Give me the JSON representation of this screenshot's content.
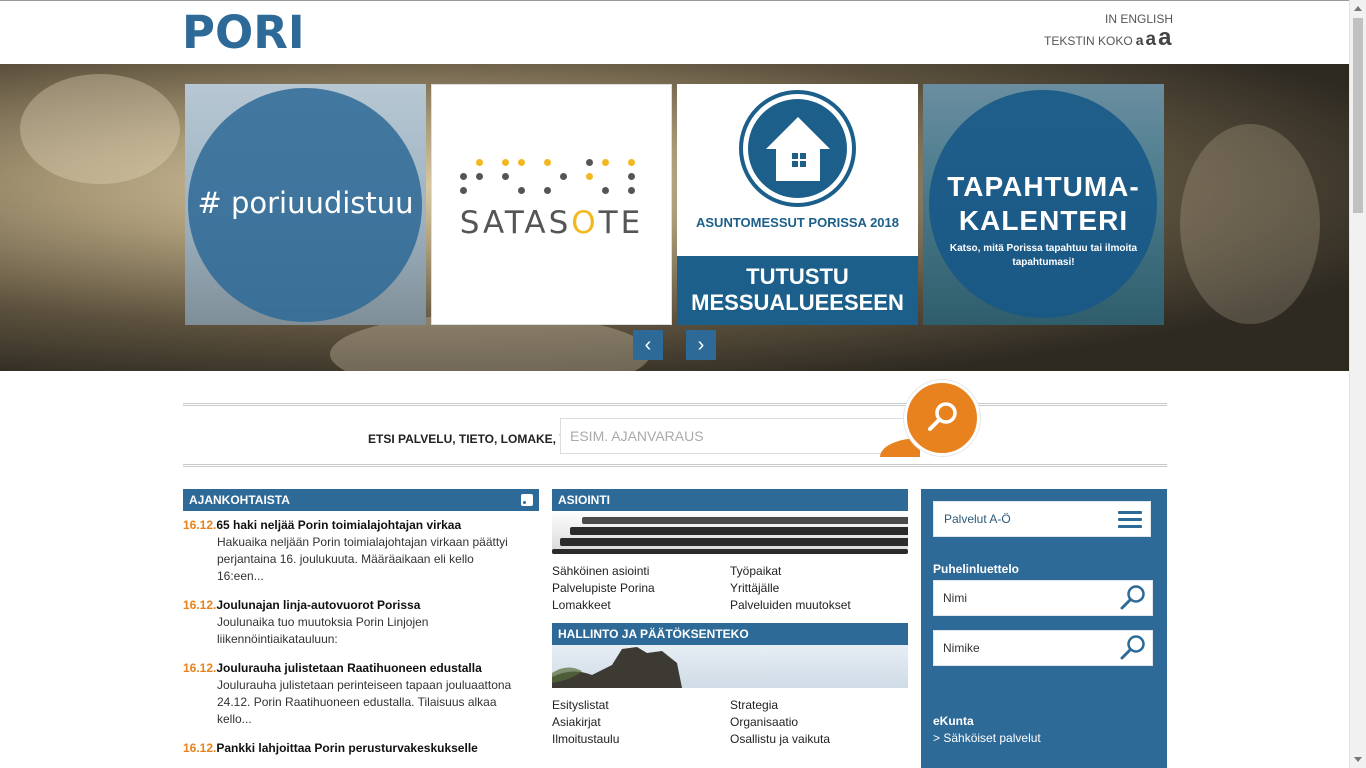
{
  "header": {
    "logo": "PORI",
    "lang_link": "IN ENGLISH",
    "font_size_label": "TEKSTIN KOKO",
    "font_size_options": [
      "a",
      "a",
      "a"
    ]
  },
  "carousel": {
    "slides": [
      {
        "text": "# poriuudistuu"
      },
      {
        "text_prefix": "SATAS",
        "text_accent": "O",
        "text_suffix": "TE"
      },
      {
        "title": "ASUNTOMESSUT PORISSA 2018",
        "band": "TUTUSTU MESSUALUEESEEN"
      },
      {
        "title": "TAPAHTUMA-KALENTERI",
        "subtitle": "Katso, mitä Porissa tapahtuu tai ilmoita tapahtumasi!"
      }
    ],
    "prev_icon": "chevron-left-icon",
    "next_icon": "chevron-right-icon"
  },
  "search": {
    "label": "ETSI PALVELU, TIETO, LOMAKE, YM.",
    "placeholder": "ESIM. AJANVARAUS",
    "button_icon": "search-icon",
    "accent_color": "#e8821e"
  },
  "news": {
    "heading": "AJANKOHTAISTA",
    "items": [
      {
        "date": "16.12.",
        "title": "65 haki neljää Porin toimialajohtajan virkaa",
        "body": "Hakuaika neljään Porin toimialajohtajan virkaan päättyi perjantaina 16. joulukuuta. Määräaikaan eli kello 16:een..."
      },
      {
        "date": "16.12.",
        "title": "Joulunajan linja-autovuorot Porissa",
        "body": "Joulunaika tuo muutoksia Porin Linjojen liikennöintiaikatauluun:"
      },
      {
        "date": "16.12.",
        "title": "Joulurauha julistetaan Raatihuoneen edustalla",
        "body": "Joulurauha julistetaan perinteiseen tapaan jouluaattona 24.12. Porin Raatihuoneen edustalla. Tilaisuus alkaa kello..."
      },
      {
        "date": "16.12.",
        "title": "Pankki lahjoittaa Porin perusturvakeskukselle",
        "body": ""
      }
    ]
  },
  "asiointi": {
    "heading": "ASIOINTI",
    "links": [
      "Sähköinen asiointi",
      "Työpaikat",
      "Palvelupiste Porina",
      "Yrittäjälle",
      "Lomakkeet",
      "Palveluiden muutokset"
    ]
  },
  "hallinto": {
    "heading": "HALLINTO JA PÄÄTÖKSENTEKO",
    "links": [
      "Esityslistat",
      "Strategia",
      "Asiakirjat",
      "Organisaatio",
      "Ilmoitustaulu",
      "Osallistu ja vaikuta"
    ]
  },
  "sidebar": {
    "services_button": "Palvelut A-Ö",
    "phonebook_heading": "Puhelinluettelo",
    "name_field": "Nimi",
    "title_field": "Nimike",
    "ekunta_heading": "eKunta",
    "ekunta_link": "> Sähköiset palvelut"
  },
  "colors": {
    "brand_blue": "#2e6a97",
    "accent_orange": "#e8821e"
  }
}
